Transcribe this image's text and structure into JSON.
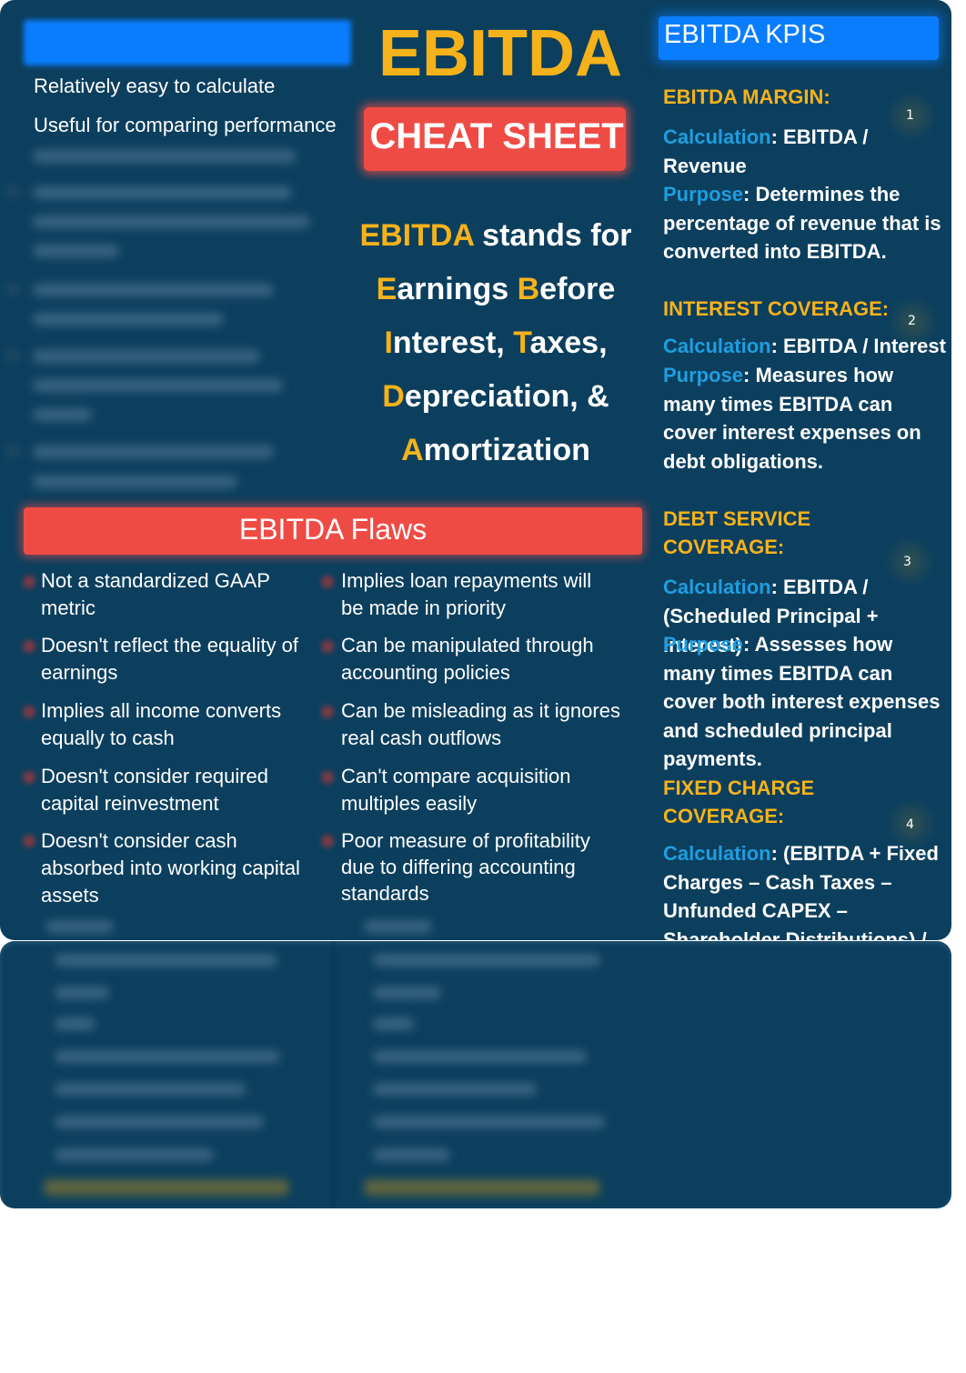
{
  "title": {
    "main": "EBITDA",
    "subtitle": "CHEAT SHEET"
  },
  "definition": {
    "lead_highlight": "EBITDA",
    "lead_rest": " stands for",
    "words": [
      {
        "initial": "E",
        "rest": "arnings "
      },
      {
        "initial": "B",
        "rest": "efore"
      },
      {
        "initial": "I",
        "rest": "nterest, "
      },
      {
        "initial": "T",
        "rest": "axes,"
      },
      {
        "initial": "D",
        "rest": "epreciation, &"
      },
      {
        "initial": "A",
        "rest": "mortization"
      }
    ]
  },
  "benefits": {
    "items": [
      "Relatively easy to calculate",
      "Useful for comparing performance"
    ]
  },
  "flaws": {
    "title": "EBITDA Flaws",
    "left": [
      "Not a standardized GAAP metric",
      "Doesn't reflect the equality of earnings",
      "Implies all income converts equally to cash",
      "Doesn't consider required capital reinvestment",
      "Doesn't consider cash absorbed into working capital assets"
    ],
    "right": [
      "Implies loan repayments will be made in priority",
      "Can be manipulated through accounting policies",
      "Can be misleading as it ignores real cash outflows",
      "Can't compare acquisition multiples easily",
      "Poor measure of profitability due to differing accounting standards"
    ]
  },
  "kpis": {
    "header": "EBITDA KPIS",
    "calc_label": "Calculation",
    "purpose_label": "Purpose",
    "items": [
      {
        "number": "1",
        "title": "EBITDA MARGIN:",
        "calculation": ": EBITDA / Revenue",
        "purpose": ": Determines the percentage of revenue that is converted into EBITDA."
      },
      {
        "number": "2",
        "title": "INTEREST COVERAGE:",
        "calculation": ": EBITDA / Interest",
        "purpose": ": Measures how many times EBITDA can cover interest expenses on debt obligations."
      },
      {
        "number": "3",
        "title": "DEBT SERVICE COVERAGE:",
        "calculation": ": EBITDA / (Scheduled Principal + Interest)",
        "purpose": ": Assesses how many times EBITDA can cover both interest expenses and scheduled principal payments."
      },
      {
        "number": "4",
        "title": "FIXED CHARGE COVERAGE:",
        "calculation": ": (EBITDA + Fixed Charges – Cash Taxes – Unfunded CAPEX – Shareholder Distributions) /",
        "purpose": ""
      }
    ]
  },
  "colors": {
    "background": "#0c3f5e",
    "gold": "#f6b21b",
    "red": "#ef4b45",
    "blue": "#0a7dff",
    "label_blue": "#1e9ee0"
  }
}
